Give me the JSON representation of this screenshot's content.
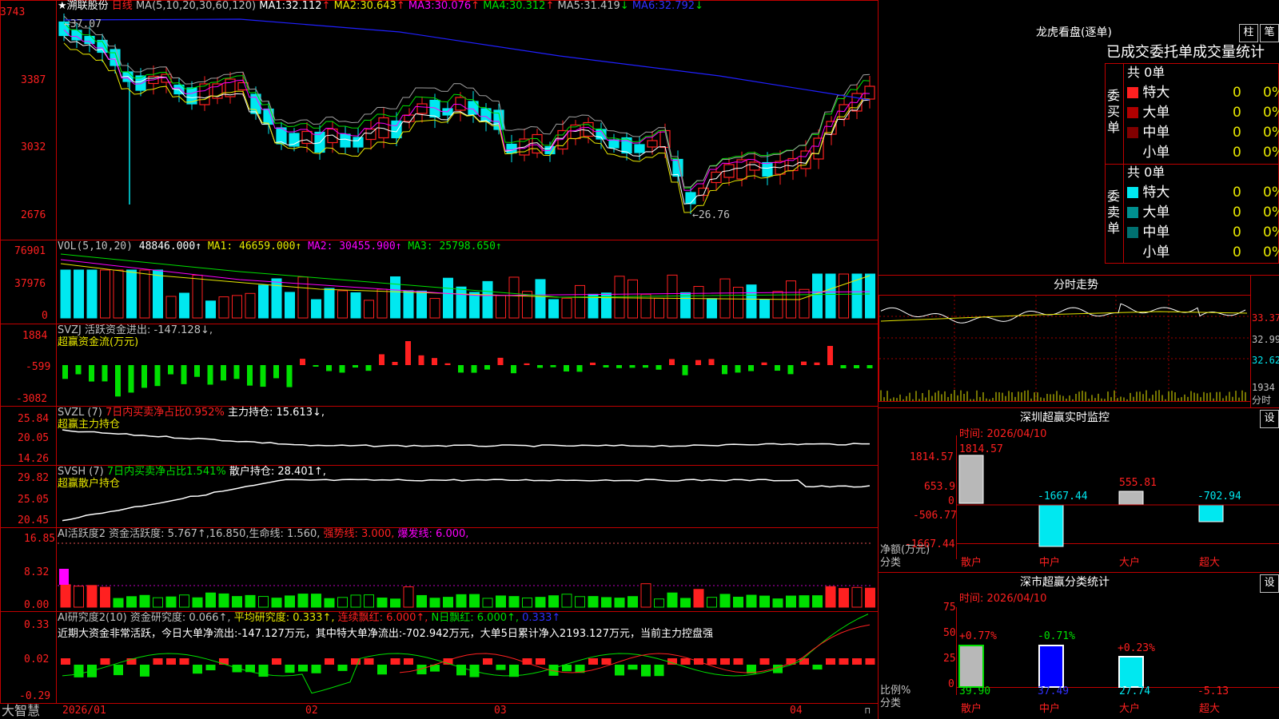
{
  "colors": {
    "up": "#ff2020",
    "down": "#00e8f0",
    "frame": "#c00000",
    "ma1": "#ffffff",
    "ma2": "#e8e800",
    "ma3": "#ff00ff",
    "ma4": "#00e000",
    "ma5": "#a0a0a0",
    "ma6": "#2020ff"
  },
  "stock": {
    "name": "★溯联股份",
    "period": "日线",
    "ma_def": "MA(5,10,20,30,60,120)",
    "ma": [
      {
        "label": "MA1:",
        "value": "32.112",
        "arrow": "↑"
      },
      {
        "label": "MA2:",
        "value": "30.643",
        "arrow": "↑"
      },
      {
        "label": "MA3:",
        "value": "30.076",
        "arrow": "↑"
      },
      {
        "label": "MA4:",
        "value": "30.312",
        "arrow": "↑"
      },
      {
        "label": "MA5:",
        "value": "31.419",
        "arrow": "↓"
      },
      {
        "label": "MA6:",
        "value": "32.792",
        "arrow": "↓"
      }
    ],
    "price_axis": [
      "3743",
      "3387",
      "3032",
      "2676"
    ],
    "high_mark": "37.07",
    "low_mark": "←26.76"
  },
  "vol": {
    "def": "VOL(5,10,20)",
    "value": "48846.000↑",
    "ma1": "MA1: 46659.000↑",
    "ma2": "MA2: 30455.900↑",
    "ma3": "MA3: 25798.650↑",
    "axis": [
      "76901",
      "37976",
      "0"
    ]
  },
  "svzj": {
    "title": "SVZJ  活跃资金进出: -147.128↓,",
    "sub": "超赢资金流(万元)",
    "axis": [
      "1884",
      "-599",
      "-3082"
    ]
  },
  "svzl": {
    "title": "SVZL (7)",
    "ratio": "7日内买卖净占比0.952%",
    "hold": "主力持仓: 15.613↓,",
    "sub": "超赢主力持仓",
    "axis": [
      "25.84",
      "20.05",
      "14.26"
    ]
  },
  "svsh": {
    "title": "SVSH (7)",
    "ratio": "7日内买卖净占比1.541%",
    "hold": "散户持仓: 28.401↑,",
    "sub": "超赢散户持仓",
    "axis": [
      "29.82",
      "25.05",
      "20.45"
    ]
  },
  "ai1": {
    "title": "AI活跃度2 资金活跃度: 5.767↑,16.850,生命线: 1.560,",
    "strong": "强势线: 3.000,",
    "burst": "爆发线: 6.000,",
    "axis": [
      "16.85",
      "8.32",
      "0.00"
    ]
  },
  "ai2": {
    "title": "AI研究度2(10) 资金研究度: 0.066↑,",
    "avg": "平均研究度: 0.333↑,",
    "red": "连续飘红: 6.000↑,",
    "nred": "N日飘红: 6.000↑,",
    "last": "0.333↑",
    "note": "近期大资金非常活跃，今日大单净流出:-147.127万元，其中特大单净流出:-702.942万元，大单5日累计净入2193.127万元，当前主力控盘强",
    "axis": [
      "0.33",
      "0.02",
      "-0.29"
    ]
  },
  "date_axis": [
    "2026/01",
    "02",
    "03",
    "04"
  ],
  "brand": "大智慧",
  "longhu": {
    "title": "龙虎看盘(逐单)",
    "btn_bar": "柱",
    "btn_pen": "笔",
    "header": "已成交委托单成交量统计",
    "buy_label": "委买单",
    "sell_label": "委卖单",
    "buy_total": "共 0单",
    "sell_total": "共 0单",
    "rows": [
      {
        "name": "特大",
        "num": "0",
        "pct": "0%"
      },
      {
        "name": "大单",
        "num": "0",
        "pct": "0%"
      },
      {
        "name": "中单",
        "num": "0",
        "pct": "0%"
      },
      {
        "name": "小单",
        "num": "0",
        "pct": "0%"
      }
    ]
  },
  "intraday": {
    "title": "分时走势",
    "axis": [
      "33.37",
      "32.99",
      "32.62",
      "1934"
    ],
    "unit": "分时"
  },
  "monitor": {
    "title": "深圳超赢实时监控",
    "btn": "设",
    "time": "时间: 2026/04/10",
    "axis": [
      "1814.57",
      "653.9",
      "0",
      "-506.77",
      "-1667.44"
    ],
    "ylabel": "净额(万元)",
    "xlabel": "分类",
    "cats": [
      "散户",
      "中户",
      "大户",
      "超大"
    ],
    "values": [
      "1814.57",
      "-1667.44",
      "555.81",
      "-702.94"
    ]
  },
  "classify": {
    "title": "深市超赢分类统计",
    "btn": "设",
    "time": "时间: 2026/04/10",
    "axis": [
      "75",
      "50",
      "25",
      "0"
    ],
    "ylabel": "比例%",
    "xlabel": "分类",
    "cats": [
      "散户",
      "中户",
      "大户",
      "超大"
    ],
    "tops": [
      "+0.77%",
      "-0.71%",
      "+0.23%",
      ""
    ],
    "bottoms": [
      "39.90",
      "37.49",
      "27.74",
      "-5.13"
    ]
  }
}
